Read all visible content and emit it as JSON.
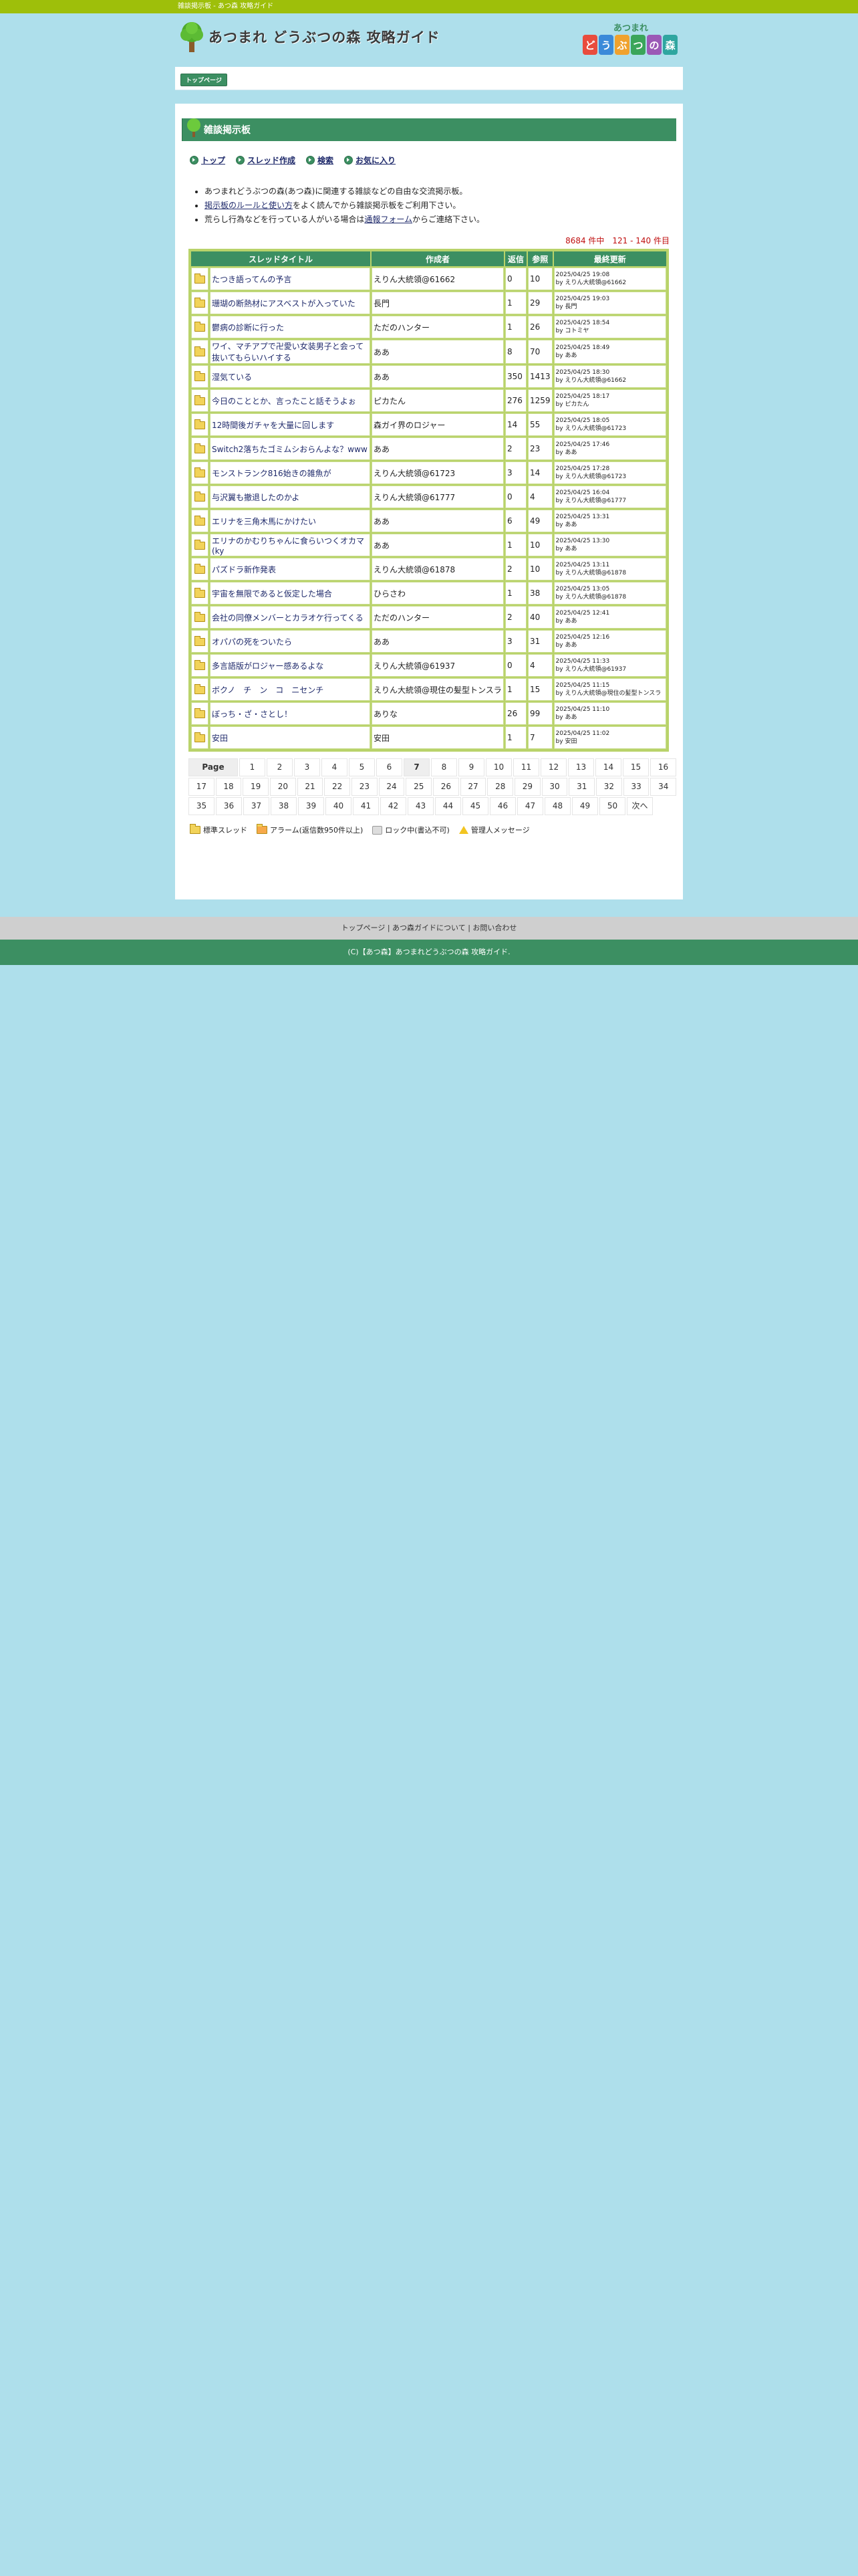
{
  "topbar": {
    "text": "雑談掲示板 - あつ森 攻略ガイド"
  },
  "header": {
    "site_title": "あつまれ どうぶつの森 攻略ガイド",
    "brand_top": "あつまれ",
    "brand_bottom": [
      "ど",
      "う",
      "ぶ",
      "つ",
      "の",
      "森"
    ]
  },
  "crumb": {
    "label": "トップページ"
  },
  "board": {
    "title": "雑談掲示板"
  },
  "menu": [
    "トップ",
    "スレッド作成",
    "検索",
    "お気に入り"
  ],
  "notes": {
    "line1": "あつまれどうぶつの森(あつ森)に関連する雑談などの自由な交流掲示板。",
    "line2_link": "掲示板のルールと使い方",
    "line2_rest": "をよく読んでから雑談掲示板をご利用下さい。",
    "line3_pre": "荒らし行為などを行っている人がいる場合は",
    "line3_link": "通報フォーム",
    "line3_post": "からご連絡下さい。"
  },
  "count": "8684 件中　121 - 140 件目",
  "table": {
    "headers": [
      "スレッドタイトル",
      "作成者",
      "返信",
      "参照",
      "最終更新"
    ],
    "rows": [
      {
        "title": "たつき語ってんの予言",
        "author": "えりん大統領@61662",
        "replies": "0",
        "views": "10",
        "date": "2025/04/25 19:08",
        "by": "by えりん大統領@61662"
      },
      {
        "title": "珊瑚の断熱材にアスベストが入っていた",
        "author": "長門",
        "replies": "1",
        "views": "29",
        "date": "2025/04/25 19:03",
        "by": "by 長門"
      },
      {
        "title": "鬱病の診断に行った",
        "author": "ただのハンター",
        "replies": "1",
        "views": "26",
        "date": "2025/04/25 18:54",
        "by": "by コトミヤ"
      },
      {
        "title": "ワイ、マチアプで卍愛い女装男子と会って抜いてもらいハイする",
        "author": "ああ",
        "replies": "8",
        "views": "70",
        "date": "2025/04/25 18:49",
        "by": "by ああ"
      },
      {
        "title": "湿気ている",
        "author": "ああ",
        "replies": "350",
        "views": "1413",
        "date": "2025/04/25 18:30",
        "by": "by えりん大統領@61662"
      },
      {
        "title": "今日のこととか、言ったこと話そうよぉ",
        "author": "ピカたん",
        "replies": "276",
        "views": "1259",
        "date": "2025/04/25 18:17",
        "by": "by ピカたん"
      },
      {
        "title": "12時間後ガチャを大量に回します",
        "author": "森ガイ界のロジャー",
        "replies": "14",
        "views": "55",
        "date": "2025/04/25 18:05",
        "by": "by えりん大統領@61723"
      },
      {
        "title": "Switch2落ちたゴミムシおらんよな？www",
        "author": "ああ",
        "replies": "2",
        "views": "23",
        "date": "2025/04/25 17:46",
        "by": "by ああ"
      },
      {
        "title": "モンストランク816始きの雑魚が",
        "author": "えりん大統領@61723",
        "replies": "3",
        "views": "14",
        "date": "2025/04/25 17:28",
        "by": "by えりん大統領@61723"
      },
      {
        "title": "与沢翼も撤退したのかよ",
        "author": "えりん大統領@61777",
        "replies": "0",
        "views": "4",
        "date": "2025/04/25 16:04",
        "by": "by えりん大統領@61777"
      },
      {
        "title": "エリナを三角木馬にかけたい",
        "author": "ああ",
        "replies": "6",
        "views": "49",
        "date": "2025/04/25 13:31",
        "by": "by ああ"
      },
      {
        "title": "エリナのかむりちゃんに食らいつくオカマ(ky",
        "author": "ああ",
        "replies": "1",
        "views": "10",
        "date": "2025/04/25 13:30",
        "by": "by ああ"
      },
      {
        "title": "パズドラ新作発表",
        "author": "えりん大統領@61878",
        "replies": "2",
        "views": "10",
        "date": "2025/04/25 13:11",
        "by": "by えりん大統領@61878"
      },
      {
        "title": "宇宙を無限であると仮定した場合",
        "author": "ひらさわ",
        "replies": "1",
        "views": "38",
        "date": "2025/04/25 13:05",
        "by": "by えりん大統領@61878"
      },
      {
        "title": "会社の同僚メンバーとカラオケ行ってくる",
        "author": "ただのハンター",
        "replies": "2",
        "views": "40",
        "date": "2025/04/25 12:41",
        "by": "by ああ"
      },
      {
        "title": "オパパの死をついたら",
        "author": "ああ",
        "replies": "3",
        "views": "31",
        "date": "2025/04/25 12:16",
        "by": "by ああ"
      },
      {
        "title": "多言語版がロジャー感あるよな",
        "author": "えりん大統領@61937",
        "replies": "0",
        "views": "4",
        "date": "2025/04/25 11:33",
        "by": "by えりん大統領@61937"
      },
      {
        "title": "ボクノ　チ　ン　コ　ニセンチ",
        "author": "えりん大統領@現住の髪型トンスラ",
        "replies": "1",
        "views": "15",
        "date": "2025/04/25 11:15",
        "by": "by えりん大統領@現住の髪型トンスラ"
      },
      {
        "title": "ぼっち・ざ・さとし！",
        "author": "ありな",
        "replies": "26",
        "views": "99",
        "date": "2025/04/25 11:10",
        "by": "by ああ"
      },
      {
        "title": "安田",
        "author": "安田",
        "replies": "1",
        "views": "7",
        "date": "2025/04/25 11:02",
        "by": "by 安田"
      }
    ]
  },
  "pager": {
    "label": "Page",
    "row1": [
      "1",
      "2",
      "3",
      "4",
      "5",
      "6",
      "7",
      "8",
      "9",
      "10",
      "11",
      "12",
      "13",
      "14",
      "15",
      "16"
    ],
    "row2": [
      "17",
      "18",
      "19",
      "20",
      "21",
      "22",
      "23",
      "24",
      "25",
      "26",
      "27",
      "28",
      "29",
      "30",
      "31",
      "32",
      "33",
      "34"
    ],
    "row3": [
      "35",
      "36",
      "37",
      "38",
      "39",
      "40",
      "41",
      "42",
      "43",
      "44",
      "45",
      "46",
      "47",
      "48",
      "49",
      "50",
      "次へ"
    ],
    "current": "7"
  },
  "legend": {
    "normal": "標準スレッド",
    "alarm": "アラーム(返信数950件以上)",
    "lock": "ロック中(書込不可)",
    "admin": "管理人メッセージ"
  },
  "footer": {
    "links": [
      "トップページ",
      "あつ森ガイドについて",
      "お問い合わせ"
    ],
    "copyright": "(C)【あつ森】あつまれどうぶつの森 攻略ガイド."
  },
  "colors": {
    "accent_green": "#3c8f62",
    "top_bar": "#9ebf0a",
    "background": "#aedfeb"
  }
}
